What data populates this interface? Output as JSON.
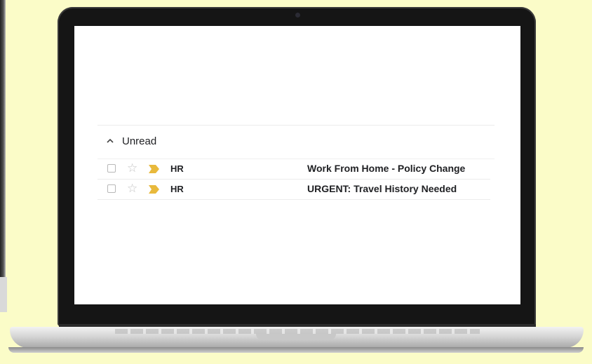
{
  "inbox": {
    "section_label": "Unread",
    "emails": [
      {
        "sender": "HR",
        "subject": "Work From Home - Policy Change",
        "starred": false,
        "important": true
      },
      {
        "sender": "HR",
        "subject": "URGENT: Travel History Needed",
        "starred": false,
        "important": true
      }
    ]
  },
  "icons": {
    "collapse": "chevron-up-icon",
    "star": "star-outline-icon",
    "importance": "importance-marker-icon"
  },
  "colors": {
    "background": "#fbfcc8",
    "importance_marker": "#e8b93c",
    "laptop_bezel": "#151515"
  }
}
